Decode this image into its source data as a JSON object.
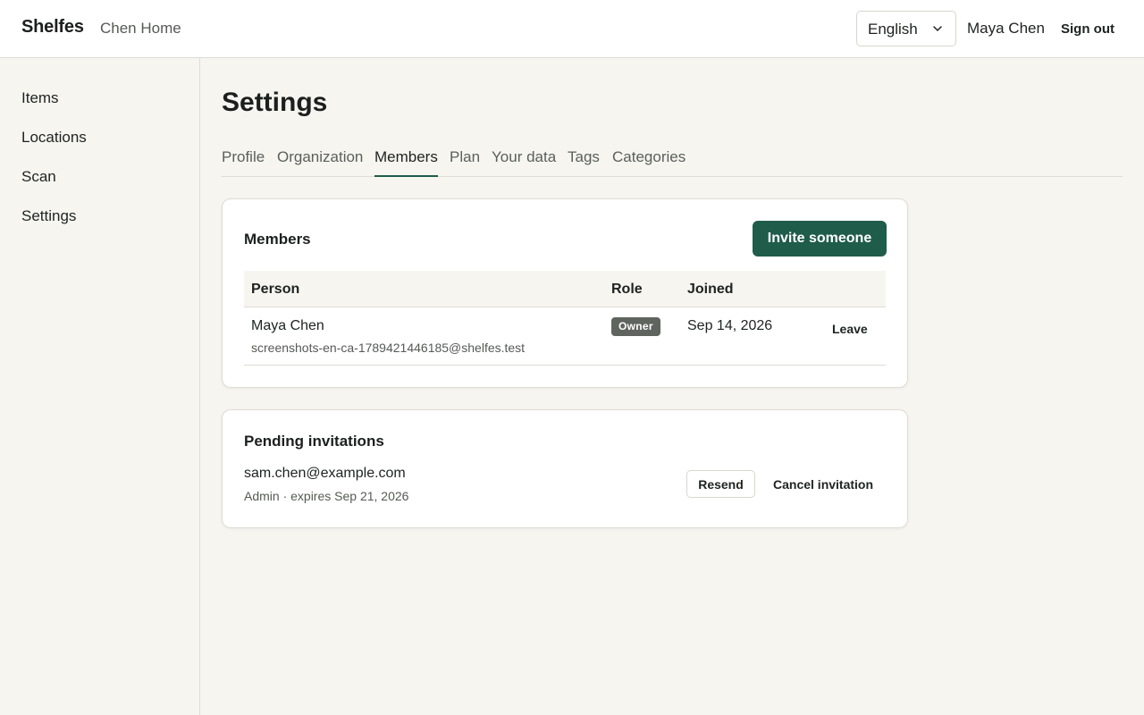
{
  "header": {
    "brand": "Shelfes",
    "org_name": "Chen Home",
    "language": "English",
    "user_name": "Maya Chen",
    "sign_out": "Sign out"
  },
  "sidebar": {
    "items": [
      {
        "label": "Items"
      },
      {
        "label": "Locations"
      },
      {
        "label": "Scan"
      },
      {
        "label": "Settings"
      }
    ]
  },
  "page": {
    "title": "Settings",
    "tabs": [
      {
        "label": "Profile",
        "active": false
      },
      {
        "label": "Organization",
        "active": false
      },
      {
        "label": "Members",
        "active": true
      },
      {
        "label": "Plan",
        "active": false
      },
      {
        "label": "Your data",
        "active": false
      },
      {
        "label": "Tags",
        "active": false
      },
      {
        "label": "Categories",
        "active": false
      }
    ]
  },
  "members": {
    "title": "Members",
    "invite_label": "Invite someone",
    "columns": {
      "person": "Person",
      "role": "Role",
      "joined": "Joined"
    },
    "rows": [
      {
        "name": "Maya Chen",
        "email": "screenshots-en-ca-1789421446185@shelfes.test",
        "role": "Owner",
        "joined": "Sep 14, 2026",
        "action": "Leave"
      }
    ]
  },
  "invitations": {
    "title": "Pending invitations",
    "items": [
      {
        "email": "sam.chen@example.com",
        "meta": "Admin · expires Sep 21, 2026",
        "resend": "Resend",
        "cancel": "Cancel invitation"
      }
    ]
  },
  "colors": {
    "accent": "#1f5c4a",
    "background": "#f6f5f0",
    "badge": "#5f645f"
  }
}
